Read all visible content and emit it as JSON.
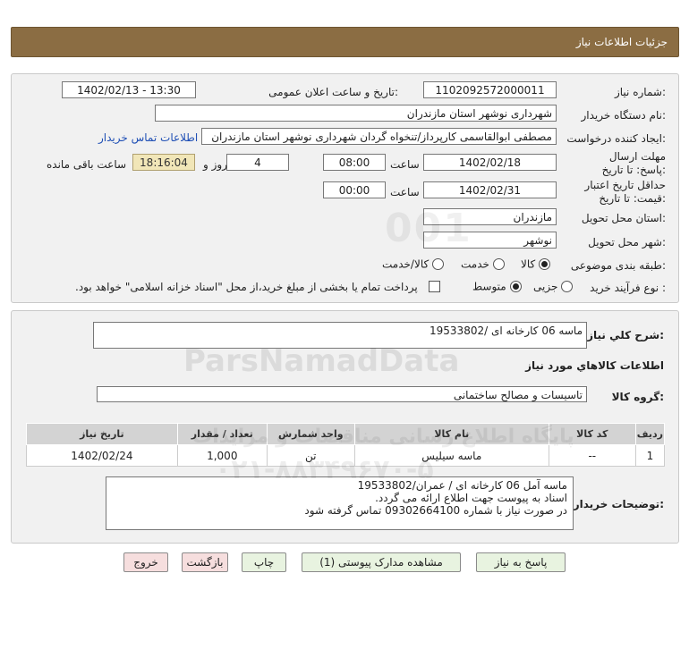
{
  "header": {
    "title": "جزئیات اطلاعات نیاز"
  },
  "form": {
    "need_number_label": "شماره نیاز:",
    "need_number": "1102092572000011",
    "announce_label": "تاریخ و ساعت اعلان عمومی:",
    "announce_value": "1402/02/13 - 13:30",
    "buyer_org_label": "نام دستگاه خریدار:",
    "buyer_org": "شهرداری نوشهر استان مازندران",
    "requester_label": "ایجاد کننده درخواست:",
    "requester": "مصطفی  ابوالقاسمی کارپرداز/تنخواه گردان شهرداری نوشهر استان مازندران",
    "contact_link": "اطلاعات تماس خریدار",
    "reply_deadline_label": "مهلت ارسال پاسخ: تا تاریخ:",
    "reply_date": "1402/02/18",
    "hour_label": "ساعت",
    "reply_time": "08:00",
    "days_value": "4",
    "days_label": "روز و",
    "remaining_time": "18:16:04",
    "remaining_label": "ساعت باقی مانده",
    "validity_label": "حداقل تاریخ اعتبار قیمت: تا تاریخ:",
    "validity_date": "1402/02/31",
    "validity_hour_label": "ساعت",
    "validity_time": "00:00",
    "province_label": "استان محل تحویل:",
    "province": "مازندران",
    "city_label": "شهر محل تحویل:",
    "city": "نوشهر",
    "category_label": "طبقه بندی موضوعی:",
    "category_options": [
      "کالا",
      "خدمت",
      "کالا/خدمت"
    ],
    "category_selected": "کالا",
    "process_label": "نوع فرآیند خرید :",
    "process_options": [
      "جزیی",
      "متوسط"
    ],
    "process_selected": "متوسط",
    "payment_note": "پرداخت تمام یا بخشی از مبلغ خرید،از محل \"اسناد خزانه اسلامی\" خواهد بود."
  },
  "details": {
    "summary_label": "شرح کلي نياز:",
    "summary": "ماسه 06 کارخانه ای /19533802",
    "goods_info_title": "اطلاعات کالاهاي مورد نياز",
    "goods_group_label": "گروه کالا:",
    "goods_group": "تاسیسات و مصالح ساختمانی",
    "table": {
      "headers": [
        "ردیف",
        "کد کالا",
        "نام کالا",
        "واحد شمارش",
        "تعداد / مقدار",
        "تاریخ نیاز"
      ],
      "rows": [
        [
          "1",
          "--",
          "ماسه سیلیس",
          "تن",
          "1,000",
          "1402/02/24"
        ]
      ]
    },
    "buyer_notes_label": "توضیحات خریدار:",
    "buyer_notes": [
      "ماسه آمل 06 کارخانه ای / عمران/19533802",
      "اسناد به پیوست جهت اطلاع ارائه می گردد.",
      "در صورت نیاز با شماره 09302664100 تماس گرفته شود"
    ]
  },
  "buttons": {
    "reply": "پاسخ به نیاز",
    "attachments": "مشاهده مدارک پیوستی (1)",
    "print": "چاپ",
    "back": "بازگشت",
    "exit": "خروج"
  },
  "watermark": {
    "brand": "ParsNamadData",
    "line1": "پایگاه اطلاع رسانی مناقصات و مزایدات",
    "phone": "۰۲۱-۸۸۳۴۹۶۷۰-۵"
  }
}
